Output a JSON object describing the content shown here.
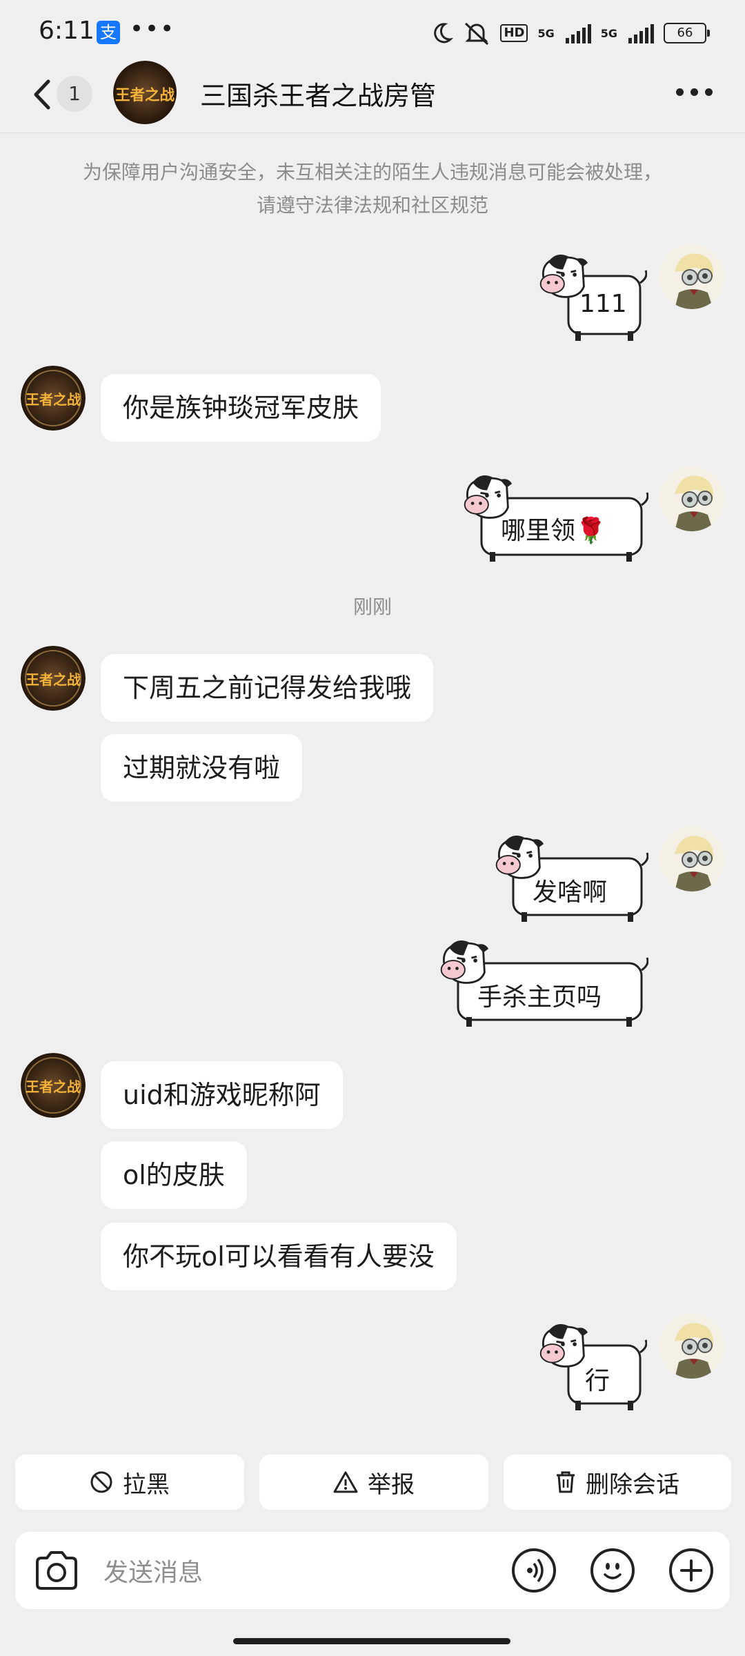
{
  "status_bar": {
    "time": "6:11",
    "app_badge": "支",
    "overflow": "•••",
    "hd_label": "HD",
    "net1": "5G",
    "net2": "5G",
    "battery": "66"
  },
  "header": {
    "unread_count": "1",
    "title": "三国杀王者之战房管"
  },
  "notice": "为保障用户沟通安全，未互相关注的陌生人违规消息可能会被处理，请遵守法律法规和社区规范",
  "timestamp": "刚刚",
  "messages": {
    "m1": "111",
    "m2": "你是族钟琰冠军皮肤",
    "m3": "哪里领🌹",
    "m4": "下周五之前记得发给我哦",
    "m5": "过期就没有啦",
    "m6": "发啥啊",
    "m7": "手杀主页吗",
    "m8": "uid和游戏昵称阿",
    "m9": "ol的皮肤",
    "m10": "你不玩ol可以看看有人要没",
    "m11": "行"
  },
  "actions": {
    "block": "拉黑",
    "report": "举报",
    "delete": "删除会话"
  },
  "input": {
    "placeholder": "发送消息"
  },
  "game_logo_text": "王者之战"
}
